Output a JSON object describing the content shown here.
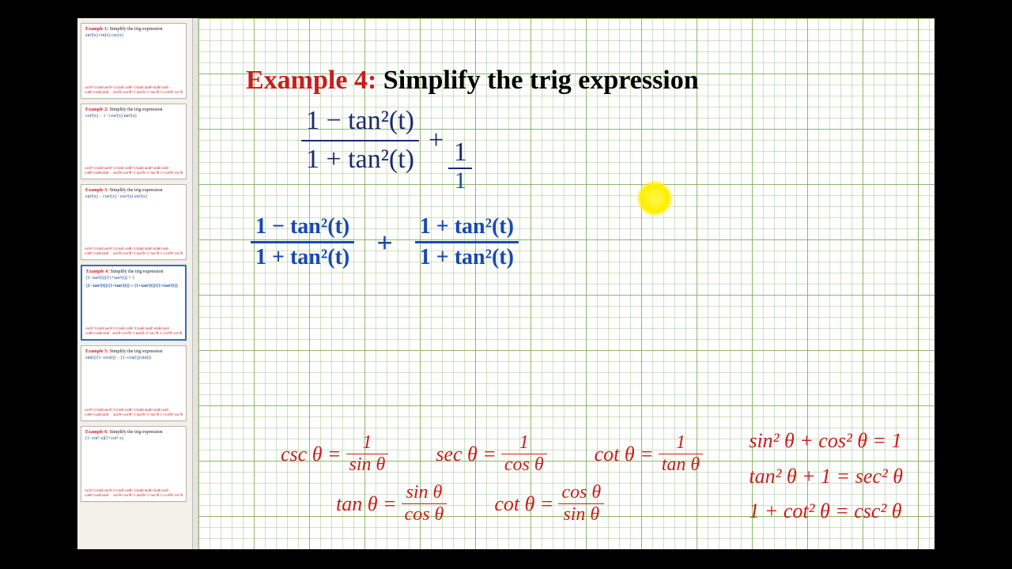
{
  "title": {
    "label": "Example 4:",
    "text": "Simplify the trig expression"
  },
  "main": {
    "numerator": "1 − tan²(t)",
    "denominator": "1 + tan²(t)",
    "plus_numerator": "1",
    "plus_denominator": "1"
  },
  "work": {
    "left": {
      "numerator": "1 − tan²(t)",
      "denominator": "1 + tan²(t)"
    },
    "op": "+",
    "right": {
      "numerator": "1 + tan²(t)",
      "denominator": "1 + tan²(t)"
    }
  },
  "identities": {
    "row1": [
      {
        "lhs": "csc θ =",
        "num": "1",
        "den": "sin θ"
      },
      {
        "lhs": "sec θ =",
        "num": "1",
        "den": "cos θ"
      },
      {
        "lhs": "cot θ =",
        "num": "1",
        "den": "tan θ"
      }
    ],
    "row2": [
      {
        "lhs": "tan θ =",
        "num": "sin θ",
        "den": "cos θ"
      },
      {
        "lhs": "cot θ =",
        "num": "cos θ",
        "den": "sin θ"
      }
    ],
    "pythag": [
      "sin² θ + cos² θ = 1",
      "tan² θ + 1 = sec² θ",
      "1 + cot² θ = csc² θ"
    ]
  },
  "thumbs": [
    {
      "title": "Example 1:",
      "sub": "Simplify the trig expression",
      "eq": "sin²(x) cot(x) csc(x)"
    },
    {
      "title": "Example 2:",
      "sub": "Simplify the trig expression",
      "eq": "cot²(x) − 1 / cos²(x) tan²(x)"
    },
    {
      "title": "Example 3:",
      "sub": "Simplify the trig expression",
      "eq": "sin²(x) − cos²(x) / cos²(x) sin²(x)"
    },
    {
      "title": "Example 4:",
      "sub": "Simplify the trig expression",
      "eq": "(1−tan²(t))/(1+tan²(t)) + 1",
      "active": true,
      "handwriting": "(1−tan²(t))/(1+tan²(t)) + (1+tan²(t))/(1+tan²(t))"
    },
    {
      "title": "Example 5:",
      "sub": "Simplify the trig expression",
      "eq": "sin(t)/(1−cos(t)) − (1−cos(t))/sin(t)"
    },
    {
      "title": "Example 6:",
      "sub": "Simplify the trig expression",
      "eq": "(1−cot² x)(1+cot² x)"
    }
  ],
  "thumb_ids_left": "cscθ=1/sinθ  secθ=1/cosθ  cotθ=1/tanθ\n tanθ=sinθ/cosθ  cotθ=cosθ/sinθ",
  "thumb_ids_right": "sin²θ+cos²θ=1\ntan²θ+1=sec²θ\n1+cot²θ=csc²θ"
}
